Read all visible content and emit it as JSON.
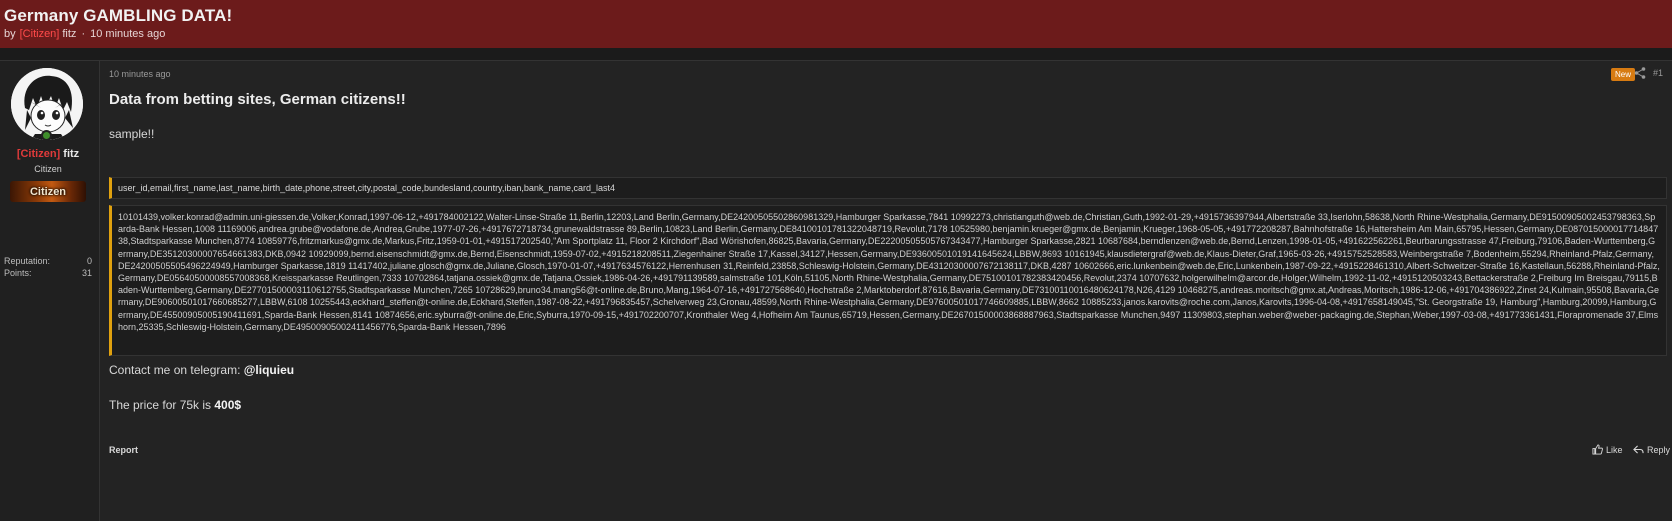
{
  "thread": {
    "title": "Germany GAMBLING DATA!",
    "by_label": "by",
    "author_tag": "[Citizen]",
    "author_name": "fitz",
    "separator": "·",
    "time_ago": "10 minutes ago"
  },
  "author": {
    "tag": "[Citizen]",
    "name": "fitz",
    "title": "Citizen",
    "rank_banner": "Citizen",
    "online_badge": "S",
    "stats": [
      {
        "label": "Reputation:",
        "value": "0"
      },
      {
        "label": "Points:",
        "value": "31"
      }
    ]
  },
  "post": {
    "time": "10 minutes ago",
    "new_badge": "New",
    "number": "#1",
    "heading": "Data from betting sites, German citizens!!",
    "sample_text": "sample!!",
    "csv_header": "user_id,email,first_name,last_name,birth_date,phone,street,city,postal_code,bundesland,country,iban,bank_name,card_last4",
    "sample_records": "10101439,volker.konrad@admin.uni-giessen.de,Volker,Konrad,1997-06-12,+491784002122,Walter-Linse-Straße 11,Berlin,12203,Land Berlin,Germany,DE24200505502860981329,Hamburger Sparkasse,7841 10992273,christianguth@web.de,Christian,Guth,1992-01-29,+4915736397944,Albertstraße 33,Iserlohn,58638,North Rhine-Westphalia,Germany,DE91500905002453798363,Sparda-Bank Hessen,1008 11169006,andrea.grube@vodafone.de,Andrea,Grube,1977-07-26,+4917672718734,grunewaldstrasse 89,Berlin,10823,Land Berlin,Germany,DE84100101781322048719,Revolut,7178 10525980,benjamin.krueger@gmx.de,Benjamin,Krueger,1968-05-05,+491772208287,Bahnhofstraße 16,Hattersheim Am Main,65795,Hessen,Germany,DE08701500001771484738,Stadtsparkasse Munchen,8774 10859776,fritzmarkus@gmx.de,Markus,Fritz,1959-01-01,+491517202540,\"Am Sportplatz 11, Floor 2 Kirchdorf\",Bad Wörishofen,86825,Bavaria,Germany,DE22200505505767343477,Hamburger Sparkasse,2821 10687684,berndlenzen@web.de,Bernd,Lenzen,1998-01-05,+491622562261,Beurbarungsstrasse 47,Freiburg,79106,Baden-Wurttemberg,Germany,DE35120300007654661383,DKB,0942 10929099,bernd.eisenschmidt@gmx.de,Bernd,Eisenschmidt,1959-07-02,+4915218208511,Ziegenhainer Straße 17,Kassel,34127,Hessen,Germany,DE93600501019141645624,LBBW,8693 10161945,klausdietergraf@web.de,Klaus-Dieter,Graf,1965-03-26,+4915752528583,Weinbergstraße 7,Bodenheim,55294,Rheinland-Pfalz,Germany,DE24200505505496224949,Hamburger Sparkasse,1819 11417402,juliane.glosch@gmx.de,Juliane,Glosch,1970-01-07,+4917634576122,Herrenhusen 31,Reinfeld,23858,Schleswig-Holstein,Germany,DE43120300007672138117,DKB,4287 10602666,eric.lunkenbein@web.de,Eric,Lunkenbein,1987-09-22,+4915228461310,Albert-Schweitzer-Straße 16,Kastellaun,56288,Rheinland-Pfalz,Germany,DE05640500008557008368,Kreissparkasse Reutlingen,7333 10702864,tatjana.ossiek@gmx.de,Tatjana,Ossiek,1986-04-26,+491791139589,salmstraße 101,Köln,51105,North Rhine-Westphalia,Germany,DE75100101782383420456,Revolut,2374 10707632,holgerwilhelm@arcor.de,Holger,Wilhelm,1992-11-02,+4915120503243,Bettackerstraße 2,Freiburg Im Breisgau,79115,Baden-Wurttemberg,Germany,DE27701500003110612755,Stadtsparkasse Munchen,7265 10728629,bruno34.mang56@t-online.de,Bruno,Mang,1964-07-16,+491727568640,Hochstraße 2,Marktoberdorf,87616,Bavaria,Germany,DE73100110016480624178,N26,4129 10468275,andreas.moritsch@gmx.at,Andreas,Moritsch,1986-12-06,+491704386922,Zinst 24,Kulmain,95508,Bavaria,Germany,DE90600501017660685277,LBBW,6108 10255443,eckhard_steffen@t-online.de,Eckhard,Steffen,1987-08-22,+491796835457,Schelverweg 23,Gronau,48599,North Rhine-Westphalia,Germany,DE97600501017746609885,LBBW,8662 10885233,janos.karovits@roche.com,Janos,Karovits,1996-04-08,+4917658149045,\"St. Georgstraße 19, Hamburg\",Hamburg,20099,Hamburg,Germany,DE45500905005190411691,Sparda-Bank Hessen,8141 10874656,eric.syburra@t-online.de,Eric,Syburra,1970-09-15,+491702200707,Kronthaler Weg 4,Hofheim Am Taunus,65719,Hessen,Germany,DE26701500003868887963,Stadtsparkasse Munchen,9497 11309803,stephan.weber@weber-packaging.de,Stephan,Weber,1997-03-08,+491773361431,Florapromenade 37,Elmshorn,25335,Schleswig-Holstein,Germany,DE49500905002411456776,Sparda-Bank Hessen,7896",
    "contact_prefix": "Contact me on telegram: ",
    "contact_handle": "@liquieu",
    "price_prefix": "The price for 75k is ",
    "price_value": "400$"
  },
  "actions": {
    "report": "Report",
    "like": "Like",
    "reply": "Reply"
  },
  "icons": {
    "share": "share-icon",
    "like": "thumbs-up-icon",
    "reply": "reply-arrow-icon",
    "avatar": "anime-avatar"
  },
  "colors": {
    "header_bg": "#6c1b1b",
    "citizen_tag": "#e03a3a",
    "code_accent": "#e0a10f",
    "new_badge": "#d77b12",
    "online": "#3f8e2b"
  }
}
